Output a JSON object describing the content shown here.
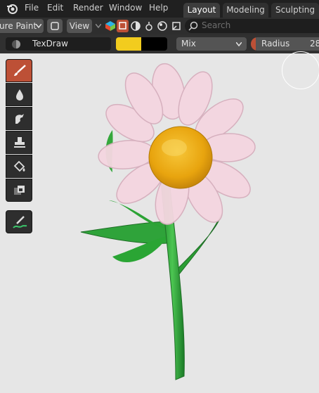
{
  "menubar": {
    "items": [
      "File",
      "Edit",
      "Render",
      "Window",
      "Help"
    ],
    "workspace_tabs": [
      "Layout",
      "Modeling",
      "Sculpting"
    ],
    "active_tab": "Layout"
  },
  "header": {
    "mode_label": "ure Paint",
    "view_label": "View",
    "search_placeholder": "Search"
  },
  "tool_settings": {
    "brush_name": "TexDraw",
    "primary_color": "#f2cc1e",
    "secondary_color": "#000000",
    "blend_mode": "Mix",
    "radius_label": "Radius",
    "radius_value": "28"
  },
  "toolbar": {
    "tools": [
      "draw-icon",
      "soften-icon",
      "smear-icon",
      "clone-icon",
      "fill-icon",
      "mask-icon"
    ],
    "active_tool": "draw-icon",
    "extra_tool": "annotate-icon"
  },
  "colors": {
    "active_tool": "#bd5036",
    "menubar_bg": "#202020",
    "viewport_bg": "#e6e6e6"
  }
}
